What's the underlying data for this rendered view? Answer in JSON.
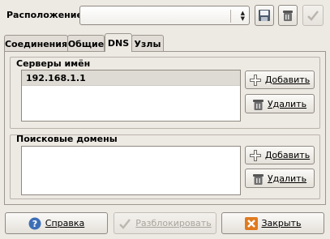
{
  "location": {
    "label": "Расположение:",
    "value": ""
  },
  "tabs": [
    {
      "label": "Соединения"
    },
    {
      "label": "Общие"
    },
    {
      "label": "DNS"
    },
    {
      "label": "Узлы"
    }
  ],
  "dns": {
    "servers": {
      "heading": "Серверы имён",
      "items": [
        "192.168.1.1"
      ],
      "add_label": "Добавить",
      "delete_label": "Удалить"
    },
    "domains": {
      "heading": "Поисковые домены",
      "items": [],
      "add_label": "Добавить",
      "delete_label": "Удалить"
    }
  },
  "footer": {
    "help_label": "Справка",
    "unlock_label": "Разблокировать",
    "close_label": "Закрыть"
  },
  "icons": [
    "save-icon",
    "delete-icon",
    "apply-check-icon",
    "add-plus-icon",
    "trash-icon",
    "help-icon",
    "unlock-check-icon",
    "close-x-icon"
  ]
}
